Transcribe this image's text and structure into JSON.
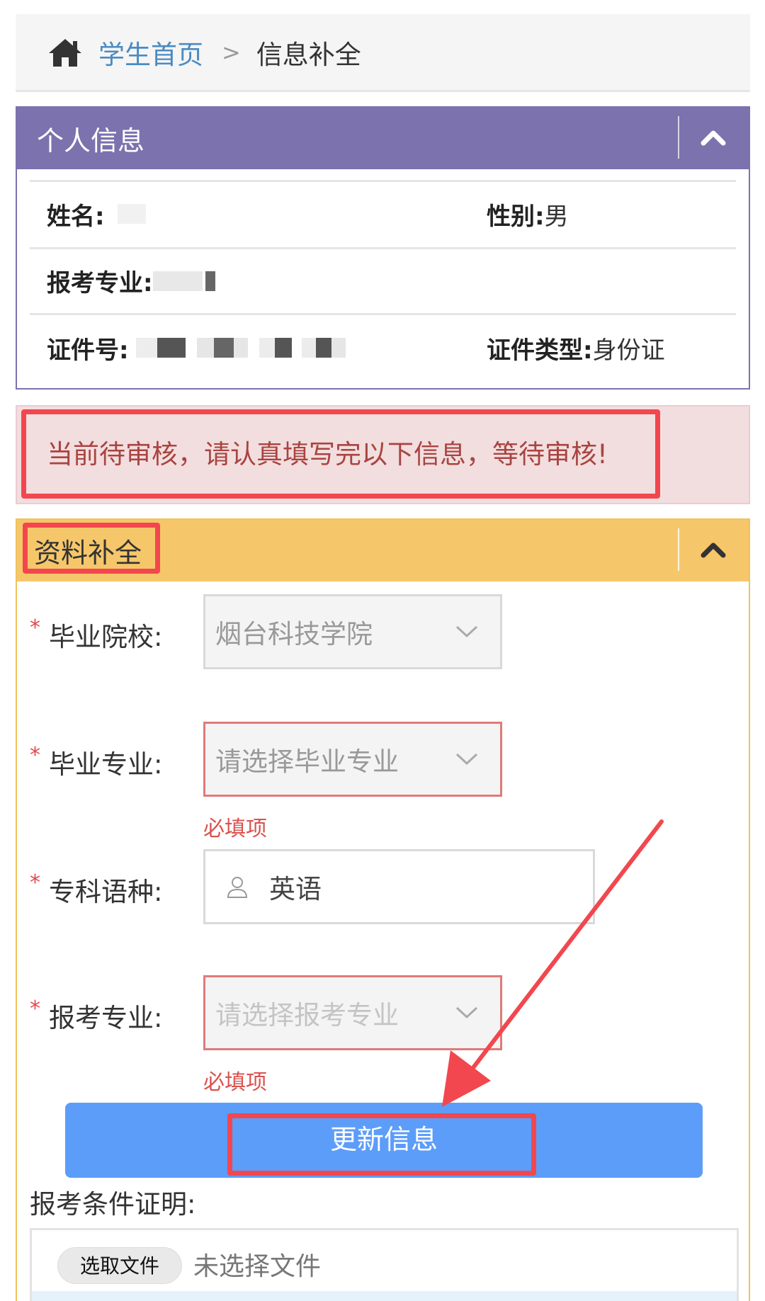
{
  "breadcrumb": {
    "home": "学生首页",
    "separator": ">",
    "current": "信息补全"
  },
  "personal_panel": {
    "title": "个人信息",
    "name_label": "姓名:",
    "gender_label": "性别:",
    "gender_value": "男",
    "major_label": "报考专业:",
    "id_label": "证件号:",
    "id_type_label": "证件类型:",
    "id_type_value": "身份证"
  },
  "alert": {
    "message": "当前待审核，请认真填写完以下信息，等待审核!"
  },
  "supplement_panel": {
    "title": "资料补全",
    "fields": {
      "school": {
        "label": "毕业院校:",
        "value": "烟台科技学院"
      },
      "grad_major": {
        "label": "毕业专业:",
        "placeholder": "请选择毕业专业",
        "error": "必填项"
      },
      "language": {
        "label": "专科语种:",
        "value": "英语"
      },
      "apply_major": {
        "label": "报考专业:",
        "placeholder": "请选择报考专业",
        "error": "必填项"
      }
    },
    "required_mark": "*",
    "update_button": "更新信息",
    "upload": {
      "label": "报考条件证明:",
      "button": "选取文件",
      "status": "未选择文件"
    }
  },
  "colors": {
    "personal_header": "#7b72ae",
    "supplement_header": "#f6c76a",
    "alert_bg": "#f2dede",
    "alert_text": "#a94442",
    "primary_button": "#5c9dfa",
    "highlight": "#f2474e"
  },
  "icons": [
    "home-icon",
    "chevron-up-icon",
    "chevron-down-icon",
    "user-icon",
    "annotation-arrow"
  ]
}
